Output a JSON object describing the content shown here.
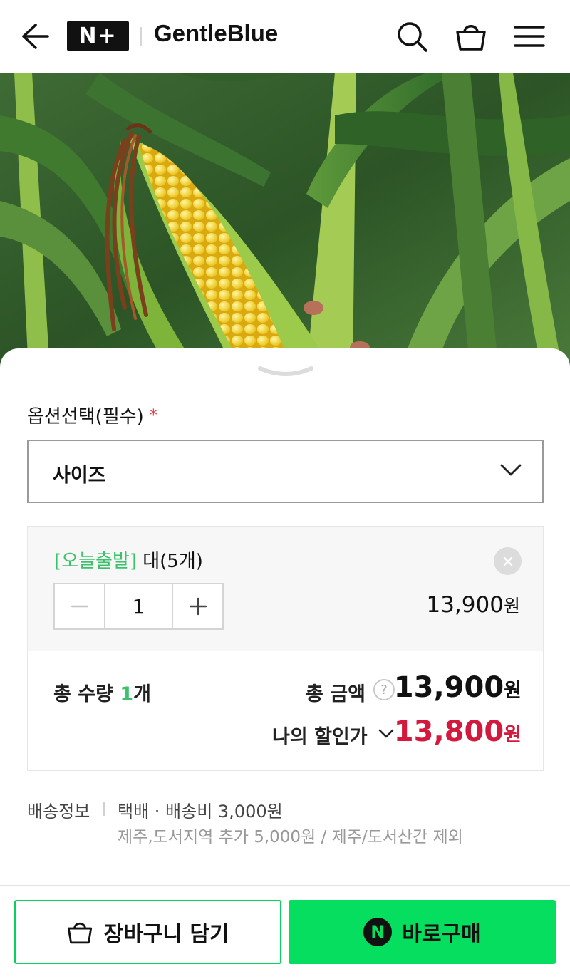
{
  "header": {
    "logo_text": "N+",
    "brand": "GentleBlue",
    "icons": [
      "back-arrow-icon",
      "search-icon",
      "shopping-bag-icon",
      "menu-icon"
    ]
  },
  "hero": {
    "description_icon": "corn-product-image"
  },
  "option": {
    "title": "옵션선택(필수)",
    "required_mark": "*",
    "select_value": "사이즈"
  },
  "selected_item": {
    "tag": "[오늘출발]",
    "name": " 대(5개)",
    "quantity": "1",
    "price": "13,900",
    "price_unit": "원"
  },
  "totals": {
    "qty_prefix": "총 수량 ",
    "qty_value": "1",
    "qty_suffix": "개",
    "amount_label": "총 금액",
    "help_symbol": "?",
    "amount": "13,900",
    "amount_unit": "원",
    "discount_label": "나의 할인가",
    "discount_amount": "13,800",
    "discount_unit": "원"
  },
  "shipping": {
    "label": "배송정보",
    "main": "택배 · 배송비 3,000원",
    "sub": "제주,도서지역 추가 5,000원 / 제주/도서산간 제외"
  },
  "actions": {
    "cart_label": "장바구니 담기",
    "buy_label": "바로구매",
    "buy_badge": "N"
  },
  "colors": {
    "accent_green": "#06de5f",
    "tag_green": "#3cc16b",
    "discount_red": "#d3193d"
  }
}
